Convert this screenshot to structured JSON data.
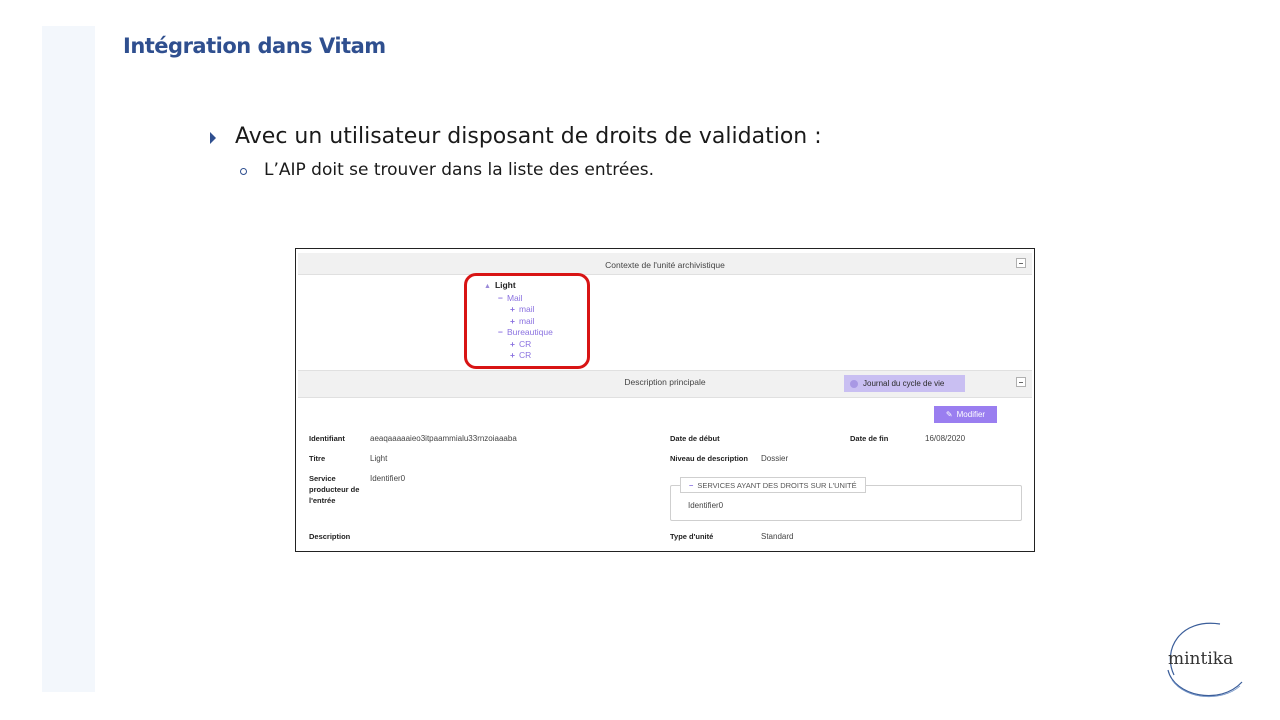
{
  "slide": {
    "title": "Intégration dans Vitam",
    "bullet_level1": "Avec un utilisateur disposant de droits de validation :",
    "bullet_level2": "L’AIP doit se trouver dans la liste des entrées."
  },
  "screenshot": {
    "context_panel": {
      "title": "Contexte de l'unité archivistique",
      "tree": {
        "root": "Light",
        "children": [
          {
            "label": "Mail",
            "symbol": "−",
            "children": [
              {
                "label": "mail",
                "symbol": "+"
              },
              {
                "label": "mail",
                "symbol": "+"
              }
            ]
          },
          {
            "label": "Bureautique",
            "symbol": "−",
            "children": [
              {
                "label": "CR",
                "symbol": "+"
              },
              {
                "label": "CR",
                "symbol": "+"
              }
            ]
          }
        ]
      }
    },
    "description_panel": {
      "title": "Description principale",
      "journal_button": "Journal du cycle de vie",
      "modifier_button": "Modifier",
      "fields": {
        "identifiant_label": "Identifiant",
        "identifiant_value": "aeaqaaaaaieo3itpaammialu33rnzoiaaaba",
        "titre_label": "Titre",
        "titre_value": "Light",
        "service_label_1": "Service",
        "service_label_2": "producteur de",
        "service_label_3": "l'entrée",
        "service_value": "Identifier0",
        "description_label": "Description",
        "date_debut_label": "Date de début",
        "date_fin_label": "Date de fin",
        "date_fin_value": "16/08/2020",
        "niveau_label": "Niveau de description",
        "niveau_value": "Dossier",
        "type_label": "Type d'unité",
        "type_value": "Standard"
      },
      "services_box": {
        "legend": "SERVICES AYANT DES DROITS SUR L'UNITÉ",
        "value": "Identifier0"
      }
    }
  },
  "logo": {
    "text": "mintika"
  },
  "colors": {
    "title_blue": "#2f4f8f",
    "accent_purple": "#9a7ef0",
    "highlight_red": "#d81414"
  }
}
